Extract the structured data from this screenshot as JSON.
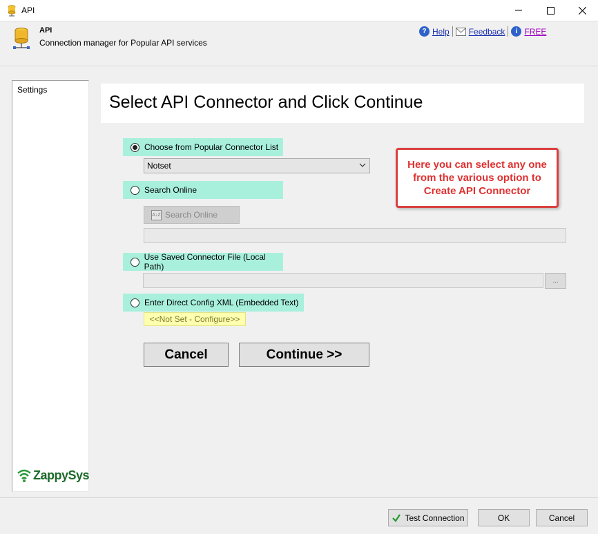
{
  "window": {
    "title": "API"
  },
  "header": {
    "title": "API",
    "subtitle": "Connection manager for Popular API services"
  },
  "links": {
    "help": "Help",
    "feedback": "Feedback",
    "free": "FREE"
  },
  "sidebar": {
    "items": [
      {
        "label": "Settings"
      }
    ],
    "logo": "ZappySys"
  },
  "main": {
    "heading": "Select API Connector and Click Continue",
    "options": [
      {
        "label": "Choose from Popular Connector List",
        "checked": true
      },
      {
        "label": "Search Online",
        "checked": false
      },
      {
        "label": "Use Saved Connector File (Local Path)",
        "checked": false
      },
      {
        "label": "Enter Direct Config XML (Embedded Text)",
        "checked": false
      }
    ],
    "connector_select": {
      "value": "Notset"
    },
    "search_button": "Search Online",
    "browse_button": "...",
    "not_set_link": "<<Not Set - Configure>>",
    "cancel_button": "Cancel",
    "continue_button": "Continue >>"
  },
  "callout": {
    "text": "Here you can select any one from the various option to Create API Connector"
  },
  "footer": {
    "test_connection": "Test Connection",
    "ok": "OK",
    "cancel": "Cancel"
  },
  "colors": {
    "accent_option_bg": "#a8f0dc",
    "callout_red": "#e03030",
    "link_blue": "#1a2fb0",
    "free_purple": "#a000c0"
  }
}
